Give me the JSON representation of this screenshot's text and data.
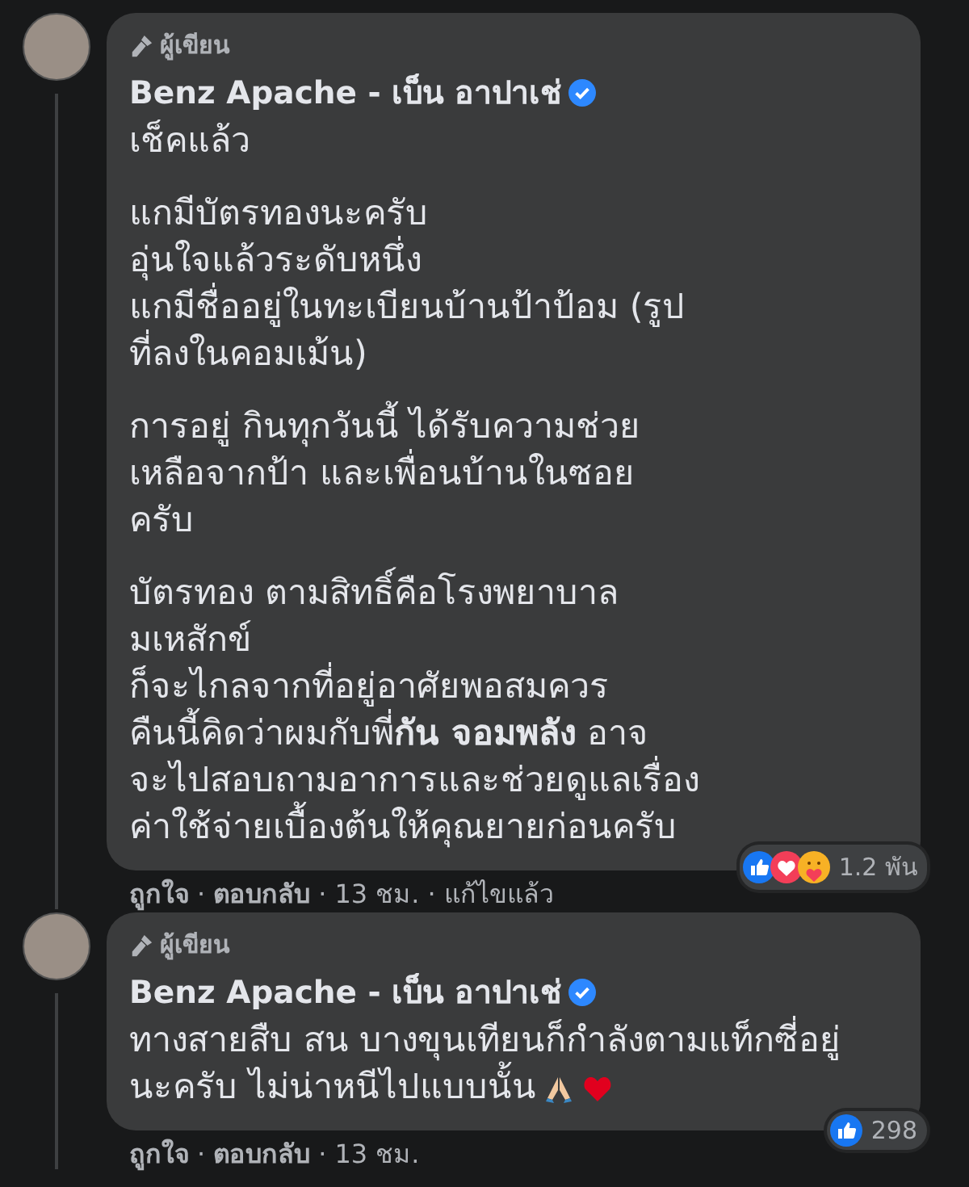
{
  "comments": [
    {
      "author_label": "ผู้เขียน",
      "name": "Benz Apache - เบ็น อาปาเช่",
      "verified": true,
      "paragraphs": [
        [
          "เช็คแล้ว"
        ],
        [
          "แกมีบัตรทองนะครับ",
          "อุ่นใจแล้วระดับหนึ่ง",
          "แกมีชื่ออยู่ในทะเบียนบ้านป้าป้อม (รูป",
          "ที่ลงในคอมเม้น)"
        ],
        [
          "การอยู่ กินทุกวันนี้ ได้รับความช่วย",
          "เหลือจากป้า และเพื่อนบ้านในซอย",
          "ครับ"
        ],
        [
          "บัตรทอง ตามสิทธิ์คือโรงพยาบาล",
          "มเหสักข์",
          "ก็จะไกลจากที่อยู่อาศัยพอสมควร",
          "คืนนี้คิดว่าผมกับพี่**กัน จอมพลัง** อาจ",
          "จะไปสอบถามอาการและช่วยดูแลเรื่อง",
          "ค่าใช้จ่ายเบื้องต้นให้คุณยายก่อนครับ"
        ]
      ],
      "reactions": {
        "kinds": [
          {
            "kind": "like"
          },
          {
            "kind": "love"
          },
          {
            "kind": "care"
          }
        ],
        "count": "1.2 พัน"
      },
      "actions": [
        "ถูกใจ",
        "ตอบกลับ",
        "13 ชม.",
        "แก้ไขแล้ว"
      ]
    },
    {
      "author_label": "ผู้เขียน",
      "name": "Benz Apache - เบ็น อาปาเช่",
      "verified": true,
      "paragraphs": [
        [
          "ทางสายสืบ สน บางขุนเทียนก็กำลังตามแท็กซี่อยู่",
          "นะครับ ไม่น่าหนีไปแบบนั้น"
        ]
      ],
      "emoji": [
        {
          "kind": "pray"
        },
        {
          "kind": "heart"
        }
      ],
      "reactions": {
        "kinds": [
          {
            "kind": "like"
          }
        ],
        "count": "298"
      },
      "actions": [
        "ถูกใจ",
        "ตอบกลับ",
        "13 ชม."
      ]
    }
  ],
  "separator": "·"
}
